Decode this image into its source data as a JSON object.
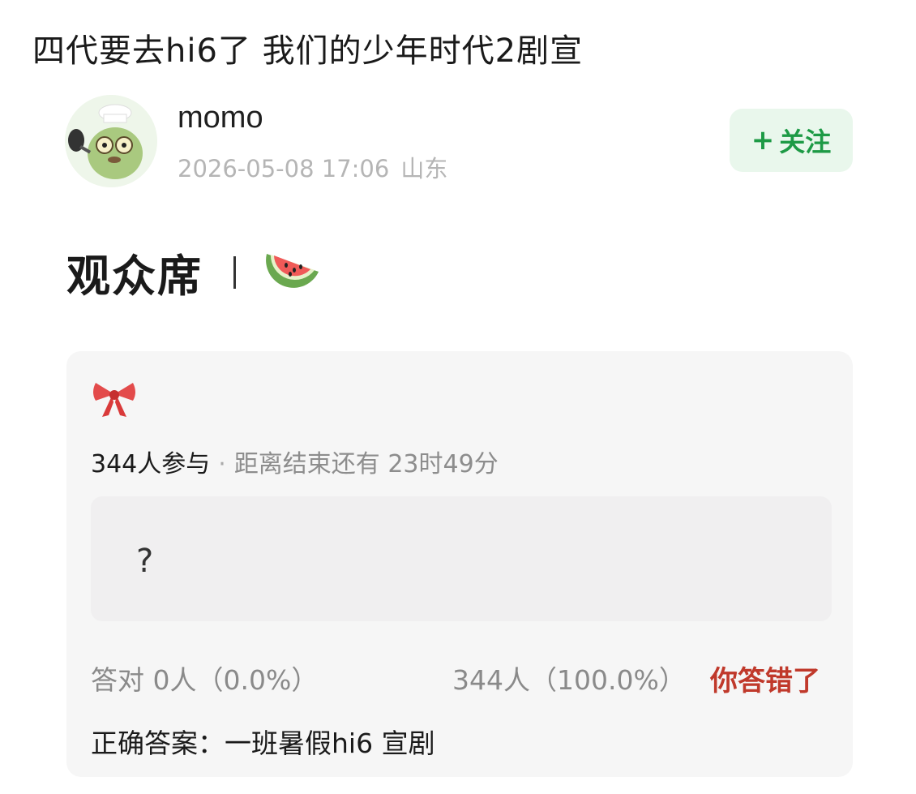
{
  "page": {
    "title": "四代要去hi6了  我们的少年时代2剧宣"
  },
  "post": {
    "username": "momo",
    "datetime": "2026-05-08 17:06",
    "location": "山东",
    "follow_label": "关注",
    "follow_prefix": "+"
  },
  "content": {
    "heading": "观众席",
    "separator": "|",
    "heading_icon": "watermelon-icon"
  },
  "quiz": {
    "icon": "bow-icon",
    "participants": "344人参与",
    "dot": "·",
    "time_remaining": "距离结束还有 23时49分",
    "question": "?",
    "correct_count": "答对  0人（0.0%）",
    "wrong_count": "344人（100.0%）",
    "result_status": "你答错了",
    "answer": "正确答案：一班暑假hi6 宣剧"
  },
  "colors": {
    "follow_green": "#1d9a45",
    "follow_bg": "#e9f7ec",
    "wrong_red": "#c0392b",
    "card_bg": "#f6f6f6"
  }
}
